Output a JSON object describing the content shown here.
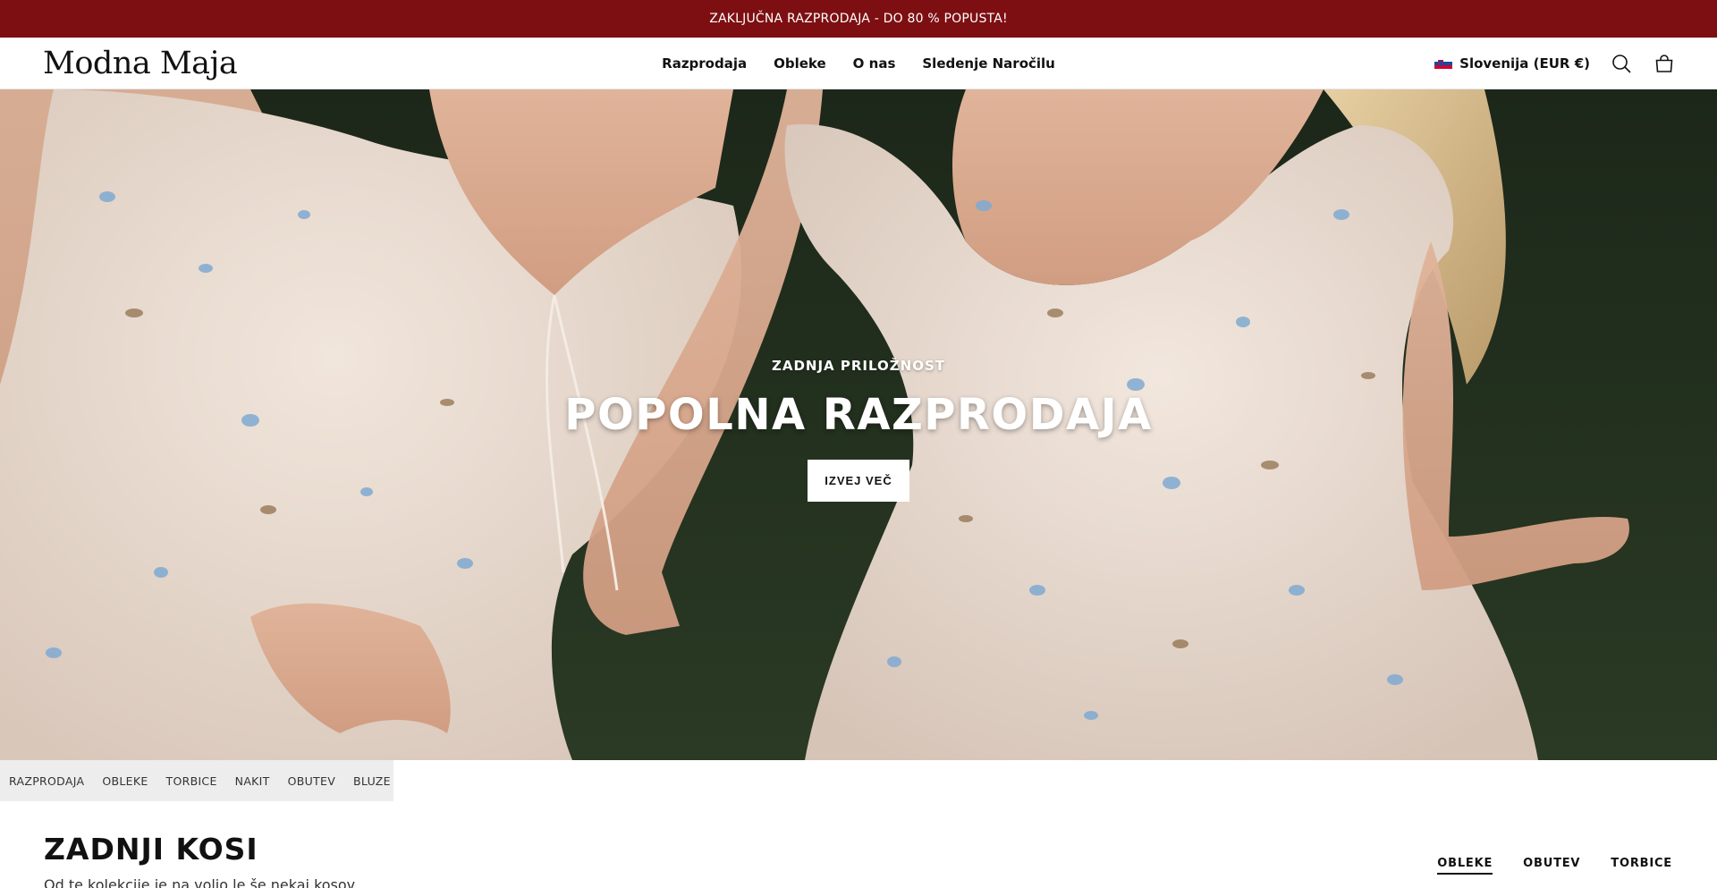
{
  "announcement": {
    "text": "ZAKLJUČNA RAZPRODAJA - DO 80 % POPUSTA!"
  },
  "header": {
    "logo": "Modna Maja",
    "nav": [
      {
        "label": "Razprodaja"
      },
      {
        "label": "Obleke"
      },
      {
        "label": "O nas"
      },
      {
        "label": "Sledenje Naročilu"
      }
    ],
    "country": "Slovenija (EUR €)",
    "icons": {
      "flag": "slovenia-flag-icon",
      "search": "search-icon",
      "cart": "bag-icon"
    }
  },
  "hero": {
    "eyebrow": "ZADNJA PRILOŽNOST",
    "title": "POPOLNA RAZPRODAJA",
    "cta": "IZVEJ VEČ"
  },
  "category_strip": {
    "items": [
      {
        "label": "RAZPRODAJA"
      },
      {
        "label": "OBLEKE"
      },
      {
        "label": "TORBICE"
      },
      {
        "label": "NAKIT"
      },
      {
        "label": "OBUTEV"
      },
      {
        "label": "BLUZE"
      }
    ]
  },
  "section": {
    "title": "ZADNJI KOSI",
    "subtitle": "Od te kolekcije je na voljo le še nekaj kosov.",
    "tabs": [
      {
        "label": "OBLEKE",
        "active": true
      },
      {
        "label": "OBUTEV",
        "active": false
      },
      {
        "label": "TORBICE",
        "active": false
      }
    ]
  },
  "colors": {
    "announcement_bg": "#7d0f12",
    "hero_grass": "#1f2b1c",
    "dress": "#eadbd0",
    "accent_flower": "#7fa9d1"
  }
}
